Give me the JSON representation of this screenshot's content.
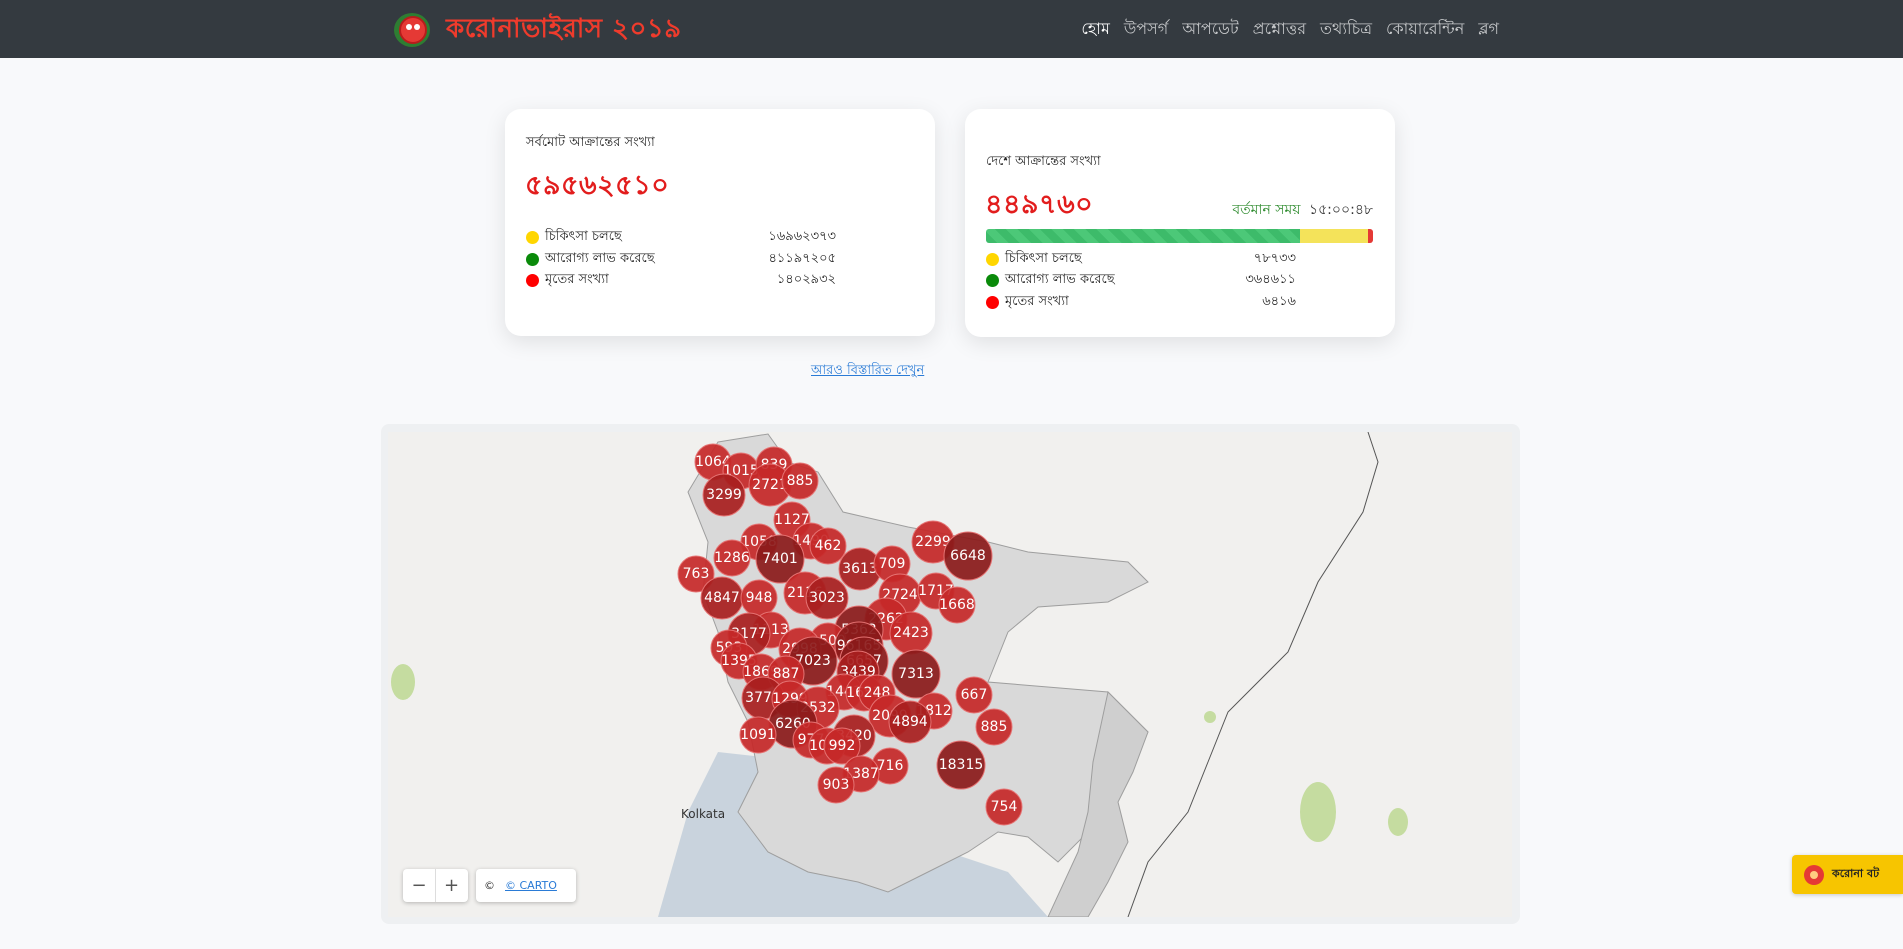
{
  "brand": {
    "title": "করোনাভাইরাস ২০১৯"
  },
  "nav": {
    "items": [
      "হোম",
      "উপসর্গ",
      "আপডেট",
      "প্রশ্নোত্তর",
      "তথ্যচিত্র",
      "কোয়ারেন্টিন",
      "ব্লগ"
    ],
    "active_index": 0
  },
  "colors": {
    "active": "#ffd600",
    "recovered": "#0a8a0a",
    "deaths": "#ff0000",
    "accent": "#e21d1d"
  },
  "global": {
    "label": "সর্বমোট আক্রান্তের সংখ্যা",
    "total": "৫৯৫৬২৫১০",
    "stats": [
      {
        "label": "চিকিৎসা চলছে",
        "value": "১৬৯৬২৩৭৩"
      },
      {
        "label": "আরোগ্য লাভ করেছে",
        "value": "৪১১৯৭২০৫"
      },
      {
        "label": "মৃতের সংখ্যা",
        "value": "১৪০২৯৩২"
      }
    ]
  },
  "country": {
    "label": "দেশে আক্রান্তের সংখ্যা",
    "total": "৪৪৯৭৬০",
    "time_label": "বর্তমান সময়",
    "time_value": "১৫:০০:৪৮",
    "progress": {
      "recovered_pct": 81.1,
      "active_pct": 17.5,
      "deaths_pct": 1.4
    },
    "stats": [
      {
        "label": "চিকিৎসা চলছে",
        "value": "৭৮৭৩৩"
      },
      {
        "label": "আরোগ্য লাভ করেছে",
        "value": "৩৬৪৬১১"
      },
      {
        "label": "মৃতের সংখ্যা",
        "value": "৬৪১৬"
      }
    ]
  },
  "details_link": "আরও বিস্তারিত দেখুন",
  "map": {
    "city_label": "Kolkata",
    "attribution_symbol": "©",
    "attribution_text": "© CARTO",
    "zoom_out": "−",
    "zoom_in": "+",
    "districts": [
      {
        "v": 1064
      },
      {
        "v": 1015
      },
      {
        "v": 839
      },
      {
        "v": 3299
      },
      {
        "v": 2721
      },
      {
        "v": 885
      },
      {
        "v": 1127
      },
      {
        "v": 1058
      },
      {
        "v": 1490
      },
      {
        "v": 462
      },
      {
        "v": 2299
      },
      {
        "v": 1286
      },
      {
        "v": 7401
      },
      {
        "v": 3613
      },
      {
        "v": 709
      },
      {
        "v": 6648
      },
      {
        "v": 763
      },
      {
        "v": 4847
      },
      {
        "v": 948
      },
      {
        "v": 2116
      },
      {
        "v": 3023
      },
      {
        "v": 2724
      },
      {
        "v": 1717
      },
      {
        "v": 1668
      },
      {
        "v": 1113
      },
      {
        "v": 2262
      },
      {
        "v": 3177
      },
      {
        "v": 5362
      },
      {
        "v": 2423
      },
      {
        "v": 593
      },
      {
        "v": 1500
      },
      {
        "v": 96165
      },
      {
        "v": 2998
      },
      {
        "v": 1395
      },
      {
        "v": 7023
      },
      {
        "v": 6657
      },
      {
        "v": 1869
      },
      {
        "v": 887
      },
      {
        "v": 3439
      },
      {
        "v": 7313
      },
      {
        "v": 3771
      },
      {
        "v": 1299
      },
      {
        "v": 1441
      },
      {
        "v": 1652
      },
      {
        "v": 248
      },
      {
        "v": 667
      },
      {
        "v": 2532
      },
      {
        "v": 1812
      },
      {
        "v": 6260
      },
      {
        "v": 2099
      },
      {
        "v": 4894
      },
      {
        "v": 1091
      },
      {
        "v": 3420
      },
      {
        "v": 977
      },
      {
        "v": 1059
      },
      {
        "v": 992
      },
      {
        "v": 885
      },
      {
        "v": 716
      },
      {
        "v": 18315
      },
      {
        "v": 1387
      },
      {
        "v": 903
      },
      {
        "v": 754
      }
    ]
  },
  "bot": {
    "label": "করোনা বট"
  }
}
